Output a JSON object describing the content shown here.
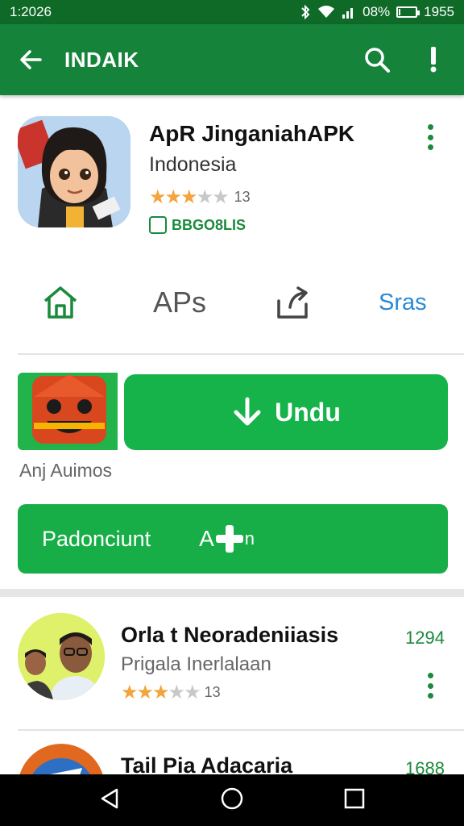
{
  "status": {
    "time": "1:2026",
    "battery_text": "08%",
    "right_text": "1955",
    "battery_level": 0.08
  },
  "app_bar": {
    "title": "INDAIK"
  },
  "app": {
    "name": "ApR JinganiahAPK",
    "developer": "Indonesia",
    "rating_stars": 3,
    "rating_count": "13",
    "badge_text": "BBGO8LIS"
  },
  "actions": {
    "apps_label": "APs",
    "share_label": "Sras"
  },
  "download": {
    "button_label": "Undu",
    "thumb_caption": "Anj Auimos"
  },
  "secondary": {
    "label": "Padonciunt",
    "label2_a": "A",
    "label2_b": "n"
  },
  "list": [
    {
      "title": "Orla t Neoradeniiasis",
      "subtitle": "Prigala Inerlalaan",
      "rating_stars": 3,
      "rating_count": "13",
      "count": "1294"
    },
    {
      "title": "Tail Pia Adacaria",
      "count": "1688"
    }
  ],
  "colors": {
    "status_bar": "#0f6a27",
    "app_bar": "#16833a",
    "accent": "#1b8a3c",
    "button": "#16b24a",
    "share_blue": "#2b8ad6"
  },
  "icons": [
    "back-arrow-icon",
    "search-icon",
    "alert-icon",
    "more-vert-icon",
    "home-icon",
    "share-icon",
    "download-icon",
    "add-icon",
    "nav-back-icon",
    "nav-home-icon",
    "nav-recents-icon"
  ]
}
